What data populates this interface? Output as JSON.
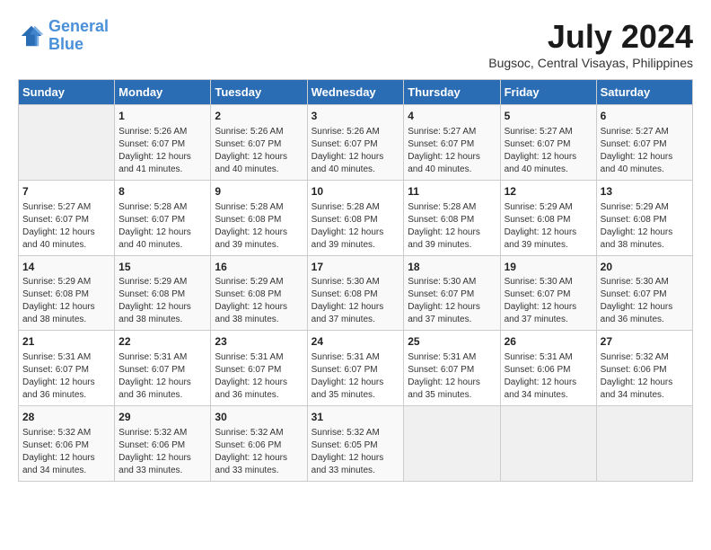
{
  "header": {
    "logo_line1": "General",
    "logo_line2": "Blue",
    "month_year": "July 2024",
    "location": "Bugsoc, Central Visayas, Philippines"
  },
  "days_of_week": [
    "Sunday",
    "Monday",
    "Tuesday",
    "Wednesday",
    "Thursday",
    "Friday",
    "Saturday"
  ],
  "weeks": [
    [
      {
        "day": "",
        "info": ""
      },
      {
        "day": "1",
        "info": "Sunrise: 5:26 AM\nSunset: 6:07 PM\nDaylight: 12 hours\nand 41 minutes."
      },
      {
        "day": "2",
        "info": "Sunrise: 5:26 AM\nSunset: 6:07 PM\nDaylight: 12 hours\nand 40 minutes."
      },
      {
        "day": "3",
        "info": "Sunrise: 5:26 AM\nSunset: 6:07 PM\nDaylight: 12 hours\nand 40 minutes."
      },
      {
        "day": "4",
        "info": "Sunrise: 5:27 AM\nSunset: 6:07 PM\nDaylight: 12 hours\nand 40 minutes."
      },
      {
        "day": "5",
        "info": "Sunrise: 5:27 AM\nSunset: 6:07 PM\nDaylight: 12 hours\nand 40 minutes."
      },
      {
        "day": "6",
        "info": "Sunrise: 5:27 AM\nSunset: 6:07 PM\nDaylight: 12 hours\nand 40 minutes."
      }
    ],
    [
      {
        "day": "7",
        "info": "Sunrise: 5:27 AM\nSunset: 6:07 PM\nDaylight: 12 hours\nand 40 minutes."
      },
      {
        "day": "8",
        "info": "Sunrise: 5:28 AM\nSunset: 6:07 PM\nDaylight: 12 hours\nand 40 minutes."
      },
      {
        "day": "9",
        "info": "Sunrise: 5:28 AM\nSunset: 6:08 PM\nDaylight: 12 hours\nand 39 minutes."
      },
      {
        "day": "10",
        "info": "Sunrise: 5:28 AM\nSunset: 6:08 PM\nDaylight: 12 hours\nand 39 minutes."
      },
      {
        "day": "11",
        "info": "Sunrise: 5:28 AM\nSunset: 6:08 PM\nDaylight: 12 hours\nand 39 minutes."
      },
      {
        "day": "12",
        "info": "Sunrise: 5:29 AM\nSunset: 6:08 PM\nDaylight: 12 hours\nand 39 minutes."
      },
      {
        "day": "13",
        "info": "Sunrise: 5:29 AM\nSunset: 6:08 PM\nDaylight: 12 hours\nand 38 minutes."
      }
    ],
    [
      {
        "day": "14",
        "info": "Sunrise: 5:29 AM\nSunset: 6:08 PM\nDaylight: 12 hours\nand 38 minutes."
      },
      {
        "day": "15",
        "info": "Sunrise: 5:29 AM\nSunset: 6:08 PM\nDaylight: 12 hours\nand 38 minutes."
      },
      {
        "day": "16",
        "info": "Sunrise: 5:29 AM\nSunset: 6:08 PM\nDaylight: 12 hours\nand 38 minutes."
      },
      {
        "day": "17",
        "info": "Sunrise: 5:30 AM\nSunset: 6:08 PM\nDaylight: 12 hours\nand 37 minutes."
      },
      {
        "day": "18",
        "info": "Sunrise: 5:30 AM\nSunset: 6:07 PM\nDaylight: 12 hours\nand 37 minutes."
      },
      {
        "day": "19",
        "info": "Sunrise: 5:30 AM\nSunset: 6:07 PM\nDaylight: 12 hours\nand 37 minutes."
      },
      {
        "day": "20",
        "info": "Sunrise: 5:30 AM\nSunset: 6:07 PM\nDaylight: 12 hours\nand 36 minutes."
      }
    ],
    [
      {
        "day": "21",
        "info": "Sunrise: 5:31 AM\nSunset: 6:07 PM\nDaylight: 12 hours\nand 36 minutes."
      },
      {
        "day": "22",
        "info": "Sunrise: 5:31 AM\nSunset: 6:07 PM\nDaylight: 12 hours\nand 36 minutes."
      },
      {
        "day": "23",
        "info": "Sunrise: 5:31 AM\nSunset: 6:07 PM\nDaylight: 12 hours\nand 36 minutes."
      },
      {
        "day": "24",
        "info": "Sunrise: 5:31 AM\nSunset: 6:07 PM\nDaylight: 12 hours\nand 35 minutes."
      },
      {
        "day": "25",
        "info": "Sunrise: 5:31 AM\nSunset: 6:07 PM\nDaylight: 12 hours\nand 35 minutes."
      },
      {
        "day": "26",
        "info": "Sunrise: 5:31 AM\nSunset: 6:06 PM\nDaylight: 12 hours\nand 34 minutes."
      },
      {
        "day": "27",
        "info": "Sunrise: 5:32 AM\nSunset: 6:06 PM\nDaylight: 12 hours\nand 34 minutes."
      }
    ],
    [
      {
        "day": "28",
        "info": "Sunrise: 5:32 AM\nSunset: 6:06 PM\nDaylight: 12 hours\nand 34 minutes."
      },
      {
        "day": "29",
        "info": "Sunrise: 5:32 AM\nSunset: 6:06 PM\nDaylight: 12 hours\nand 33 minutes."
      },
      {
        "day": "30",
        "info": "Sunrise: 5:32 AM\nSunset: 6:06 PM\nDaylight: 12 hours\nand 33 minutes."
      },
      {
        "day": "31",
        "info": "Sunrise: 5:32 AM\nSunset: 6:05 PM\nDaylight: 12 hours\nand 33 minutes."
      },
      {
        "day": "",
        "info": ""
      },
      {
        "day": "",
        "info": ""
      },
      {
        "day": "",
        "info": ""
      }
    ]
  ]
}
